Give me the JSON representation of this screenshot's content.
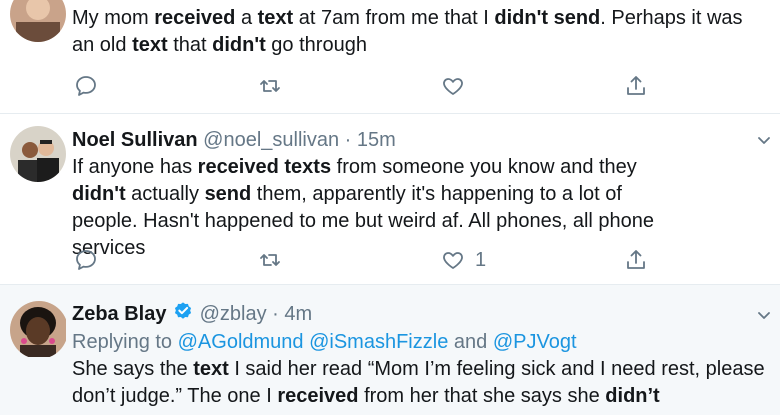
{
  "tweet1": {
    "text_segments": [
      {
        "t": "My mom ",
        "b": false
      },
      {
        "t": "received",
        "b": true
      },
      {
        "t": " a ",
        "b": false
      },
      {
        "t": "text",
        "b": true
      },
      {
        "t": " at 7am from me that I ",
        "b": false
      },
      {
        "t": "didn't send",
        "b": true
      },
      {
        "t": ". Perhaps it was an old ",
        "b": false
      },
      {
        "t": "text",
        "b": true
      },
      {
        "t": " that ",
        "b": false
      },
      {
        "t": "didn't",
        "b": true
      },
      {
        "t": " go through",
        "b": false
      }
    ]
  },
  "tweet2": {
    "name": "Noel Sullivan",
    "handle": "@noel_sullivan",
    "dot": "·",
    "time": "15m",
    "text_segments": [
      {
        "t": "If anyone has ",
        "b": false
      },
      {
        "t": "received texts",
        "b": true
      },
      {
        "t": " from someone you know and they ",
        "b": false
      },
      {
        "t": "didn't",
        "b": true
      },
      {
        "t": " actually ",
        "b": false
      },
      {
        "t": "send",
        "b": true
      },
      {
        "t": " them, apparently it's happening to a lot of people. Hasn't happened to me but weird af. All phones, all phone services",
        "b": false
      }
    ],
    "like_count": "1"
  },
  "tweet3": {
    "name": "Zeba Blay",
    "handle": "@zblay",
    "dot": "·",
    "time": "4m",
    "replying_prefix": "Replying to ",
    "replying_mentions": "@AGoldmund @iSmashFizzle",
    "replying_and": " and ",
    "replying_last": "@PJVogt",
    "text_segments": [
      {
        "t": "She says the ",
        "b": false
      },
      {
        "t": "text",
        "b": true
      },
      {
        "t": " I said her read “Mom I’m feeling sick and I need rest, please don’t judge.” The one I ",
        "b": false
      },
      {
        "t": "received",
        "b": true
      },
      {
        "t": " from her that she says she ",
        "b": false
      },
      {
        "t": "didn’t",
        "b": true
      }
    ]
  },
  "icons": [
    "reply-icon",
    "retweet-icon",
    "like-icon",
    "share-icon",
    "caret-down-icon",
    "verified-icon"
  ],
  "colors": {
    "text": "#14171a",
    "secondary": "#657786",
    "link": "#1b95e0",
    "verified": "#1da1f2",
    "divider": "#e6ecf0"
  }
}
